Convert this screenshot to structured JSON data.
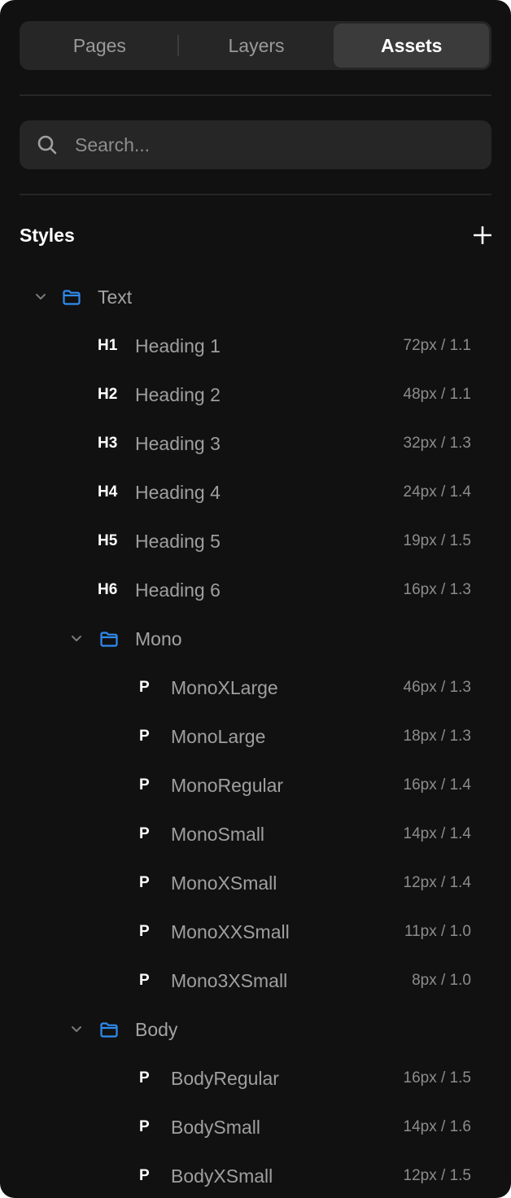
{
  "tabs": [
    {
      "label": "Pages",
      "active": false
    },
    {
      "label": "Layers",
      "active": false
    },
    {
      "label": "Assets",
      "active": true
    }
  ],
  "search": {
    "placeholder": "Search...",
    "value": "",
    "icon": "search-icon"
  },
  "styles": {
    "title": "Styles",
    "add_icon": "plus-icon",
    "groups": {
      "text": {
        "label": "Text",
        "expanded": true,
        "items": [
          {
            "tag": "H1",
            "name": "Heading 1",
            "meta": "72px / 1.1"
          },
          {
            "tag": "H2",
            "name": "Heading 2",
            "meta": "48px / 1.1"
          },
          {
            "tag": "H3",
            "name": "Heading 3",
            "meta": "32px / 1.3"
          },
          {
            "tag": "H4",
            "name": "Heading 4",
            "meta": "24px / 1.4"
          },
          {
            "tag": "H5",
            "name": "Heading 5",
            "meta": "19px / 1.5"
          },
          {
            "tag": "H6",
            "name": "Heading 6",
            "meta": "16px / 1.3"
          }
        ]
      },
      "mono": {
        "label": "Mono",
        "expanded": true,
        "items": [
          {
            "tag": "P",
            "name": "MonoXLarge",
            "meta": "46px / 1.3"
          },
          {
            "tag": "P",
            "name": "MonoLarge",
            "meta": "18px / 1.3"
          },
          {
            "tag": "P",
            "name": "MonoRegular",
            "meta": "16px / 1.4"
          },
          {
            "tag": "P",
            "name": "MonoSmall",
            "meta": "14px / 1.4"
          },
          {
            "tag": "P",
            "name": "MonoXSmall",
            "meta": "12px / 1.4"
          },
          {
            "tag": "P",
            "name": "MonoXXSmall",
            "meta": "11px / 1.0"
          },
          {
            "tag": "P",
            "name": "Mono3XSmall",
            "meta": "8px / 1.0"
          }
        ]
      },
      "body": {
        "label": "Body",
        "expanded": true,
        "items": [
          {
            "tag": "P",
            "name": "BodyRegular",
            "meta": "16px / 1.5"
          },
          {
            "tag": "P",
            "name": "BodySmall",
            "meta": "14px / 1.6"
          },
          {
            "tag": "P",
            "name": "BodyXSmall",
            "meta": "12px / 1.5"
          }
        ]
      }
    }
  },
  "colors": {
    "panel_bg": "#111111",
    "control_bg": "#262626",
    "active_tab_bg": "#3b3b3b",
    "folder_icon": "#2f8cf0",
    "primary_text": "#ffffff",
    "secondary_text": "#9f9f9f"
  }
}
